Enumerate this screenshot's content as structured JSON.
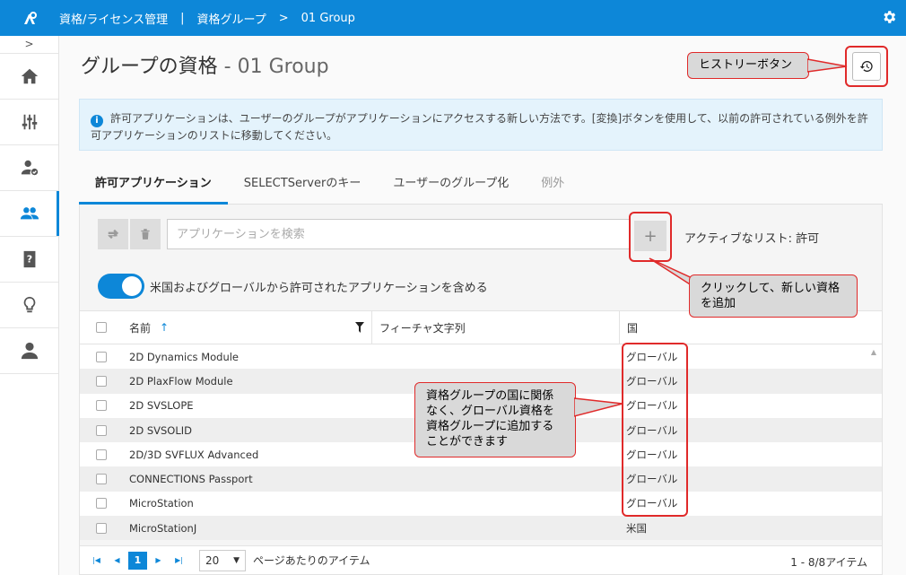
{
  "header": {
    "app_title": "資格/ライセンス管理",
    "separator": "|",
    "breadcrumb_parent": "資格グループ",
    "breadcrumb_arrow": ">",
    "breadcrumb_current": "01 Group"
  },
  "sidebar": {
    "collapse": ">",
    "items": [
      {
        "name": "home",
        "icon": "home-icon"
      },
      {
        "name": "settings-sliders",
        "icon": "sliders-icon"
      },
      {
        "name": "user-check",
        "icon": "user-check-icon"
      },
      {
        "name": "groups",
        "icon": "users-icon",
        "active": true
      },
      {
        "name": "help-book",
        "icon": "help-book-icon"
      },
      {
        "name": "ideas",
        "icon": "lightbulb-icon"
      },
      {
        "name": "profile",
        "icon": "user-icon"
      }
    ]
  },
  "page": {
    "title": "グループの資格",
    "title_dash": " - ",
    "title_group": "01 Group"
  },
  "info_banner": {
    "text": "許可アプリケーションは、ユーザーのグループがアプリケーションにアクセスする新しい方法です。[変換]ボタンを使用して、以前の許可されている例外を許可アプリケーションのリストに移動してください。"
  },
  "tabs": [
    {
      "label": "許可アプリケーション",
      "state": "active"
    },
    {
      "label": "SELECTServerのキー",
      "state": "normal"
    },
    {
      "label": "ユーザーのグループ化",
      "state": "normal"
    },
    {
      "label": "例外",
      "state": "disabled"
    }
  ],
  "toolbar": {
    "search_placeholder": "アプリケーションを検索",
    "add_label": "+",
    "active_list": "アクティブなリスト: 許可"
  },
  "toggle": {
    "label": "米国およびグローバルから許可されたアプリケーションを含める",
    "on": true
  },
  "grid": {
    "columns": {
      "name": "名前",
      "sort_indicator": "↑",
      "feature": "フィーチャ文字列",
      "country": "国"
    },
    "rows": [
      {
        "name": "2D Dynamics Module",
        "country": "グローバル"
      },
      {
        "name": "2D PlaxFlow Module",
        "country": "グローバル"
      },
      {
        "name": "2D SVSLOPE",
        "country": "グローバル"
      },
      {
        "name": "2D SVSOLID",
        "country": "グローバル"
      },
      {
        "name": "2D/3D SVFLUX Advanced",
        "country": "グローバル"
      },
      {
        "name": "CONNECTIONS Passport",
        "country": "グローバル"
      },
      {
        "name": "MicroStation",
        "country": "グローバル"
      },
      {
        "name": "MicroStationJ",
        "country": "米国"
      }
    ]
  },
  "pager": {
    "current_page": "1",
    "page_size": "20",
    "per_page_label": "ページあたりのアイテム",
    "range": "1 - 8/8アイテム"
  },
  "annotations": {
    "history": "ヒストリーボタン",
    "add": "クリックして、新しい資格を追加",
    "country": "資格グループの国に関係なく、グローバル資格を資格グループに追加することができます"
  },
  "colors": {
    "accent": "#0d87d8",
    "annotation_border": "#e02a2a",
    "annotation_bg": "#d9d9d9",
    "info_bg": "#e4f3fc"
  }
}
